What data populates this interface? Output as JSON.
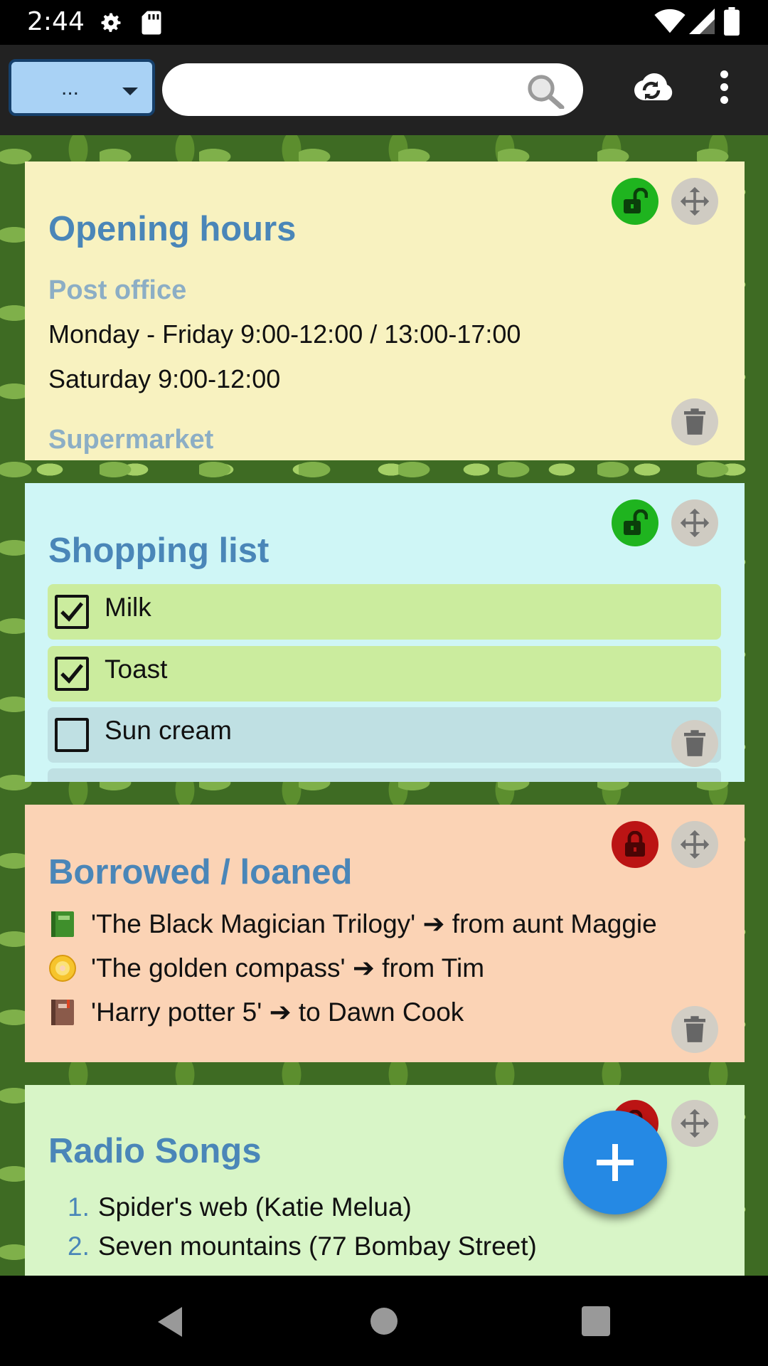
{
  "status_bar": {
    "time": "2:44"
  },
  "app_bar": {
    "category_selector": "...",
    "search": {
      "value": "",
      "placeholder": ""
    }
  },
  "notes": [
    {
      "title": "Opening hours",
      "color": "#f8f2c0",
      "locked": false,
      "sections": [
        {
          "heading": "Post office",
          "lines": [
            "Monday - Friday 9:00-12:00 / 13:00-17:00",
            "Saturday 9:00-12:00"
          ]
        },
        {
          "heading": "Supermarket",
          "lines": []
        }
      ]
    },
    {
      "title": "Shopping list",
      "color": "#cff6f6",
      "locked": false,
      "items": [
        {
          "label": "Milk",
          "checked": true
        },
        {
          "label": "Toast",
          "checked": true
        },
        {
          "label": "Sun cream",
          "checked": false
        }
      ]
    },
    {
      "title": "Borrowed / loaned",
      "color": "#fbd3b5",
      "locked": true,
      "items": [
        {
          "icon": "green-book-icon",
          "text": "'The Black Magician Trilogy' ➔ from aunt Maggie"
        },
        {
          "icon": "dvd-icon",
          "text": "'The golden compass' ➔ from Tim"
        },
        {
          "icon": "brown-book-icon",
          "text": "'Harry potter 5' ➔ to Dawn Cook"
        }
      ]
    },
    {
      "title": "Radio Songs",
      "color": "#d8f5c7",
      "locked": true,
      "items": [
        {
          "number": "1.",
          "text": "Spider's web (Katie Melua)"
        },
        {
          "number": "2.",
          "text": "Seven mountains (77 Bombay Street)"
        }
      ]
    }
  ],
  "colors": {
    "title": "#4a86b8",
    "subheading": "#8caec5",
    "lock_open": "#1fb41f",
    "lock_closed": "#bb1414",
    "fab": "#2589e4",
    "checked_row": "#cbec9e",
    "unchecked_row": "#bfe0e3"
  }
}
